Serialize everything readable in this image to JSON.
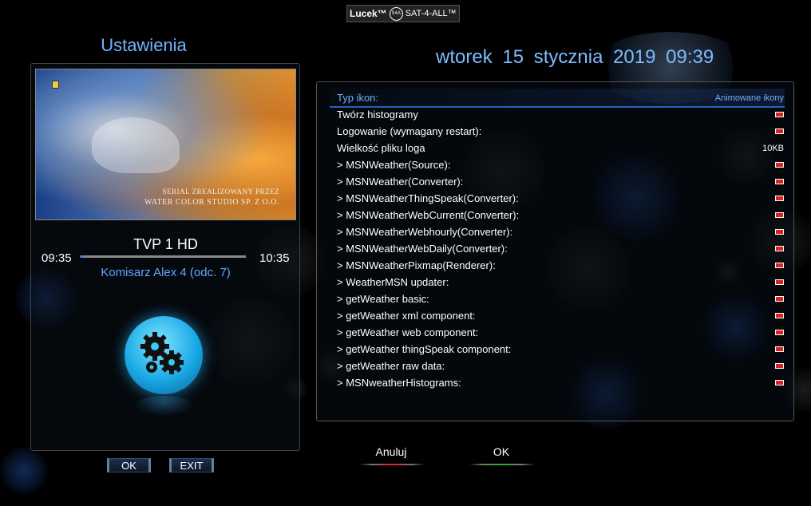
{
  "brand": {
    "name": "Lucek™",
    "disc": "SAT-4-ALL",
    "text": "SAT-4-ALL™"
  },
  "left": {
    "title": "Ustawienia"
  },
  "datetime": {
    "text": "wtorek  15  stycznia  2019   09:39"
  },
  "preview": {
    "caption_line1": "SERIAL ZREALIZOWANY PRZEZ",
    "caption_line2": "WATER COLOR STUDIO SP. Z O.O."
  },
  "now_playing": {
    "channel": "TVP 1 HD",
    "start": "09:35",
    "end": "10:35",
    "event": "Komisarz Alex 4 (odc. 7)",
    "progress": 0.02
  },
  "buttons": {
    "ok": "OK",
    "exit": "EXIT",
    "red": "Anuluj",
    "green": "OK"
  },
  "colors": {
    "accent": "#6fb4ff",
    "red": "#e02020",
    "green": "#1fb71f"
  },
  "menu": [
    {
      "label": "Typ ikon:",
      "value": "Animowane ikony",
      "selected": true
    },
    {
      "label": "Twórz histogramy",
      "flag": true
    },
    {
      "label": "Logowanie (wymagany restart):",
      "flag": true
    },
    {
      "label": "Wielkość pliku loga",
      "value": "10KB"
    },
    {
      "label": "> MSNWeather(Source):",
      "flag": true
    },
    {
      "label": "> MSNWeather(Converter):",
      "flag": true
    },
    {
      "label": "> MSNWeatherThingSpeak(Converter):",
      "flag": true
    },
    {
      "label": "> MSNWeatherWebCurrent(Converter):",
      "flag": true
    },
    {
      "label": "> MSNWeatherWebhourly(Converter):",
      "flag": true
    },
    {
      "label": "> MSNWeatherWebDaily(Converter):",
      "flag": true
    },
    {
      "label": "> MSNWeatherPixmap(Renderer):",
      "flag": true
    },
    {
      "label": "> WeatherMSN updater:",
      "flag": true
    },
    {
      "label": "> getWeather basic:",
      "flag": true
    },
    {
      "label": "> getWeather xml component:",
      "flag": true
    },
    {
      "label": "> getWeather web component:",
      "flag": true
    },
    {
      "label": "> getWeather thingSpeak component:",
      "flag": true
    },
    {
      "label": "> getWeather raw data:",
      "flag": true
    },
    {
      "label": "> MSNweatherHistograms:",
      "flag": true
    }
  ]
}
